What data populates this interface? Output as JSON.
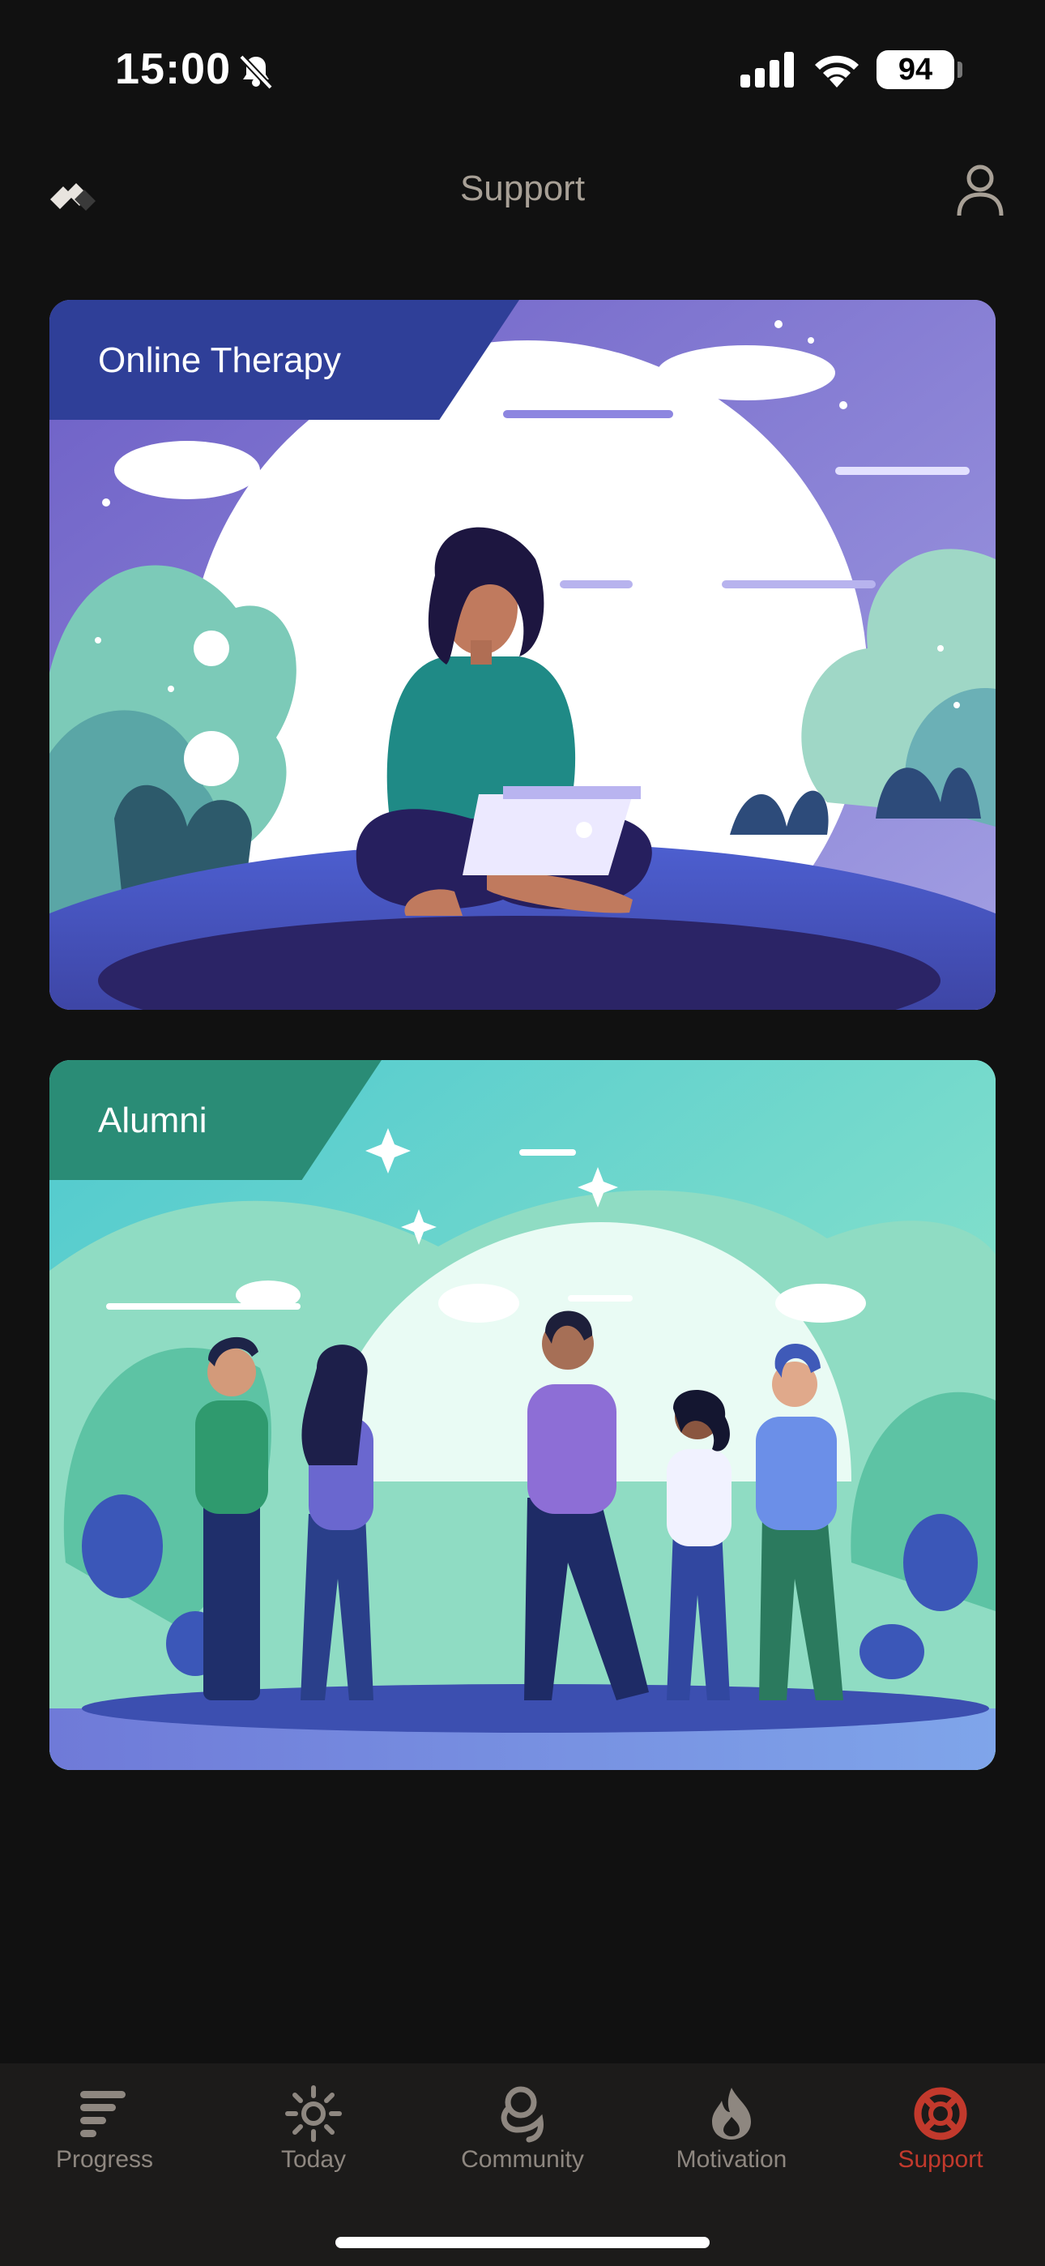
{
  "status_bar": {
    "time": "15:00",
    "battery": "94"
  },
  "header": {
    "title": "Support"
  },
  "cards": [
    {
      "label": "Online Therapy"
    },
    {
      "label": "Alumni"
    }
  ],
  "tabs": [
    {
      "label": "Progress",
      "icon": "progress-icon"
    },
    {
      "label": "Today",
      "icon": "sun-icon"
    },
    {
      "label": "Community",
      "icon": "community-icon"
    },
    {
      "label": "Motivation",
      "icon": "flame-icon"
    },
    {
      "label": "Support",
      "icon": "lifebuoy-icon",
      "active": true
    }
  ],
  "colors": {
    "background": "#111111",
    "active_tab": "#c2392c",
    "inactive_tab": "#8e8780",
    "card1_tag": "#2f3f98",
    "card2_tag": "#2a8c76"
  }
}
